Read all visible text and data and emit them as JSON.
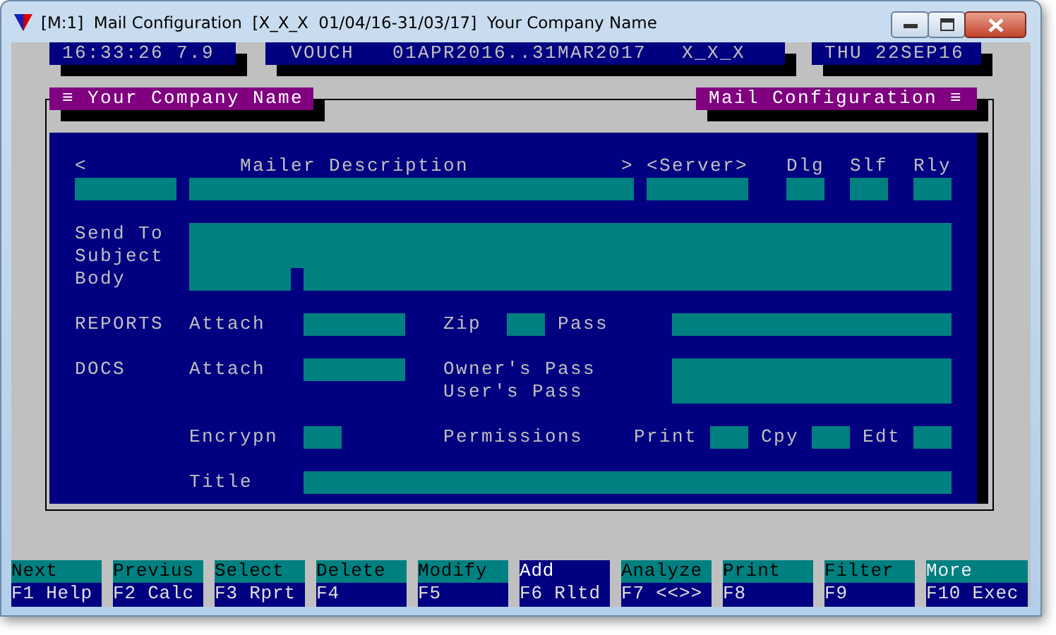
{
  "window": {
    "title": "[M:1]  Mail Configuration  [X_X_X  01/04/16-31/03/17]  Your Company Name"
  },
  "status_bar": {
    "clock": "16:33:26 7.9",
    "module": "VOUCH",
    "period": "01APR2016..31MAR2017",
    "company_code": "X_X_X",
    "date": "THU 22SEP16"
  },
  "tabs": {
    "left": "≡ Your Company Name",
    "right": "Mail Configuration ≡"
  },
  "mailer_header": {
    "prev": "<",
    "title": "Mailer Description",
    "next": ">",
    "server": "<Server>",
    "dlg": "Dlg",
    "slf": "Slf",
    "rly": "Rly"
  },
  "message_labels": [
    "Send To",
    "Subject",
    "Body"
  ],
  "reports": {
    "label": "REPORTS",
    "attach": "Attach",
    "zip": "Zip",
    "pass": "Pass"
  },
  "docs": {
    "label": "DOCS",
    "attach": "Attach",
    "owner_pass": "Owner's Pass",
    "user_pass": "User's Pass",
    "encrypt": "Encrypn",
    "permissions": "Permissions",
    "print": "Print",
    "copy": "Cpy",
    "edit": "Edt",
    "title": "Title"
  },
  "function_keys": [
    {
      "action": "Next",
      "key": "F1 Help",
      "selected": false,
      "emphasis": false
    },
    {
      "action": "Previus",
      "key": "F2 Calc",
      "selected": false,
      "emphasis": false
    },
    {
      "action": "Select",
      "key": "F3 Rprt",
      "selected": false,
      "emphasis": false
    },
    {
      "action": "Delete",
      "key": "F4",
      "selected": false,
      "emphasis": false
    },
    {
      "action": "Modify",
      "key": "F5",
      "selected": false,
      "emphasis": false
    },
    {
      "action": "Add",
      "key": "F6 Rltd",
      "selected": true,
      "emphasis": false
    },
    {
      "action": "Analyze",
      "key": "F7 <<>>",
      "selected": false,
      "emphasis": false
    },
    {
      "action": "Print",
      "key": "F8",
      "selected": false,
      "emphasis": false
    },
    {
      "action": "Filter",
      "key": "F9",
      "selected": false,
      "emphasis": false
    },
    {
      "action": "More",
      "key": "F10 Exec",
      "selected": false,
      "emphasis": true
    }
  ]
}
